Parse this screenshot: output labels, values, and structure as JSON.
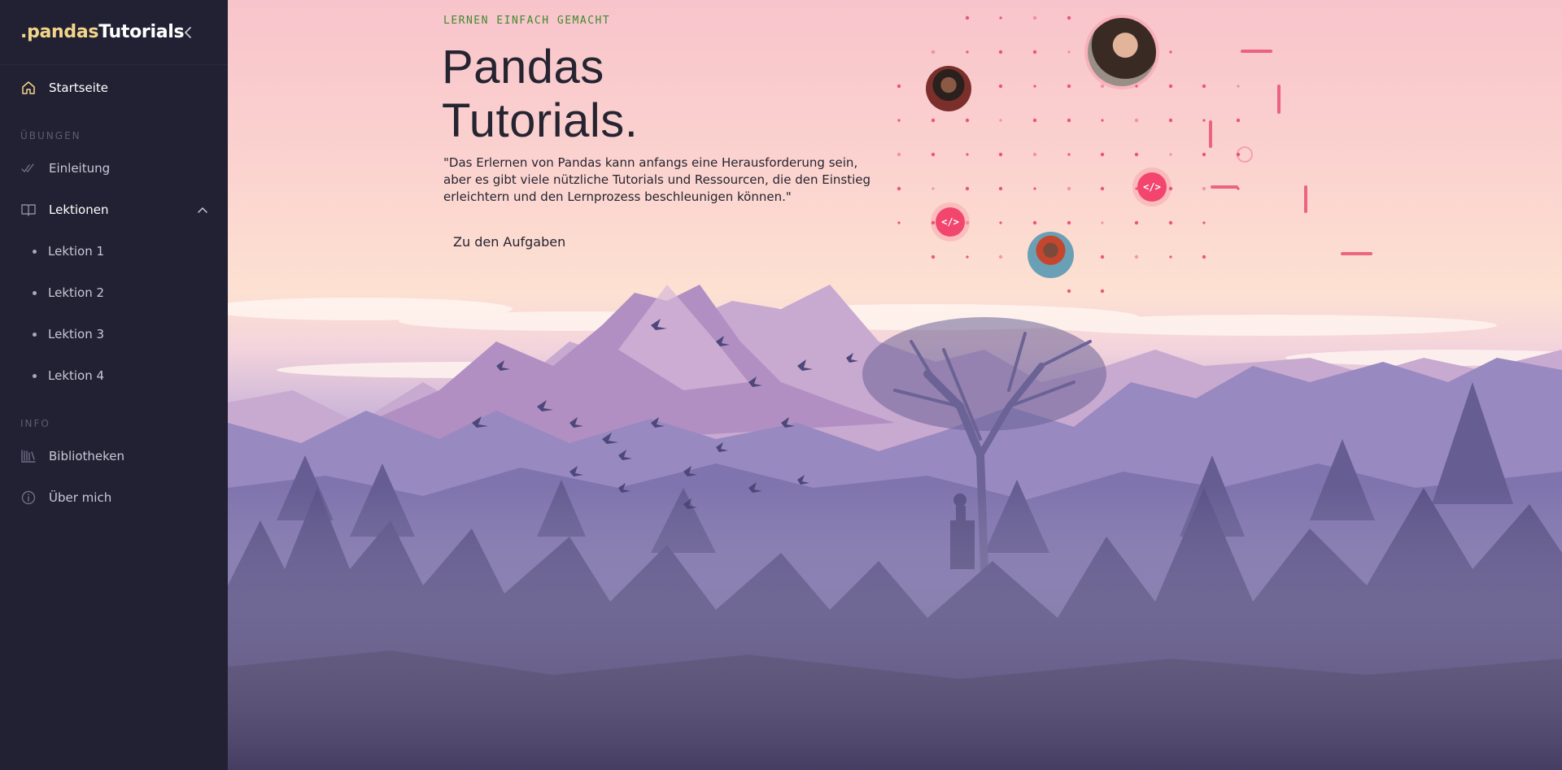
{
  "brand": {
    "dot": ".",
    "pandas": "pandas",
    "tutorials": "Tutorials"
  },
  "sidebar": {
    "home": {
      "label": "Startseite",
      "icon": "home-icon"
    },
    "section_exercises": "ÜBUNGEN",
    "einleitung": {
      "label": "Einleitung",
      "icon": "check-double-icon"
    },
    "lektionen": {
      "label": "Lektionen",
      "icon": "book-icon",
      "expanded": true
    },
    "lessons": [
      "Lektion 1",
      "Lektion 2",
      "Lektion 3",
      "Lektion 4"
    ],
    "section_info": "INFO",
    "bibliotheken": {
      "label": "Bibliotheken",
      "icon": "library-icon"
    },
    "about": {
      "label": "Über mich",
      "icon": "info-icon"
    }
  },
  "hero": {
    "eyebrow": "LERNEN EINFACH GEMACHT",
    "title_line1": "Pandas",
    "title_line2": "Tutorials.",
    "quote": "\"Das Erlernen von Pandas kann anfangs eine Herausforderung sein, aber es gibt viele nützliche Tutorials und Ressourcen, die den Einstieg erleichtern und den Lernprozess beschleunigen können.\"",
    "cta": "Zu den Aufgaben",
    "code_symbol": "</>"
  },
  "colors": {
    "sidebar_bg": "#222133",
    "accent_pink": "#f2466f",
    "brand_yellow": "#f3d58a",
    "eyebrow_green": "#3f8a2e"
  }
}
